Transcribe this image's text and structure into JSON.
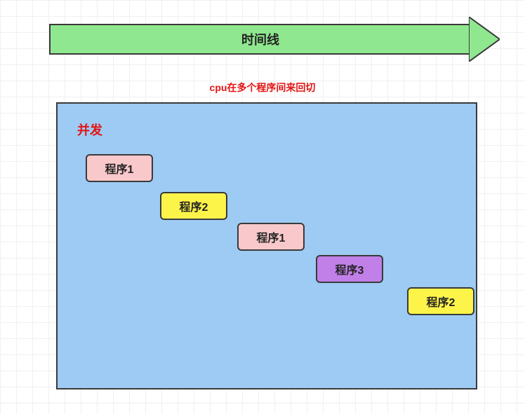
{
  "timeline": {
    "label": "时间线"
  },
  "caption": "cpu在多个程序间来回切",
  "panel": {
    "title": "并发",
    "programs": [
      {
        "label": "程序1",
        "color": "pink"
      },
      {
        "label": "程序2",
        "color": "yellow"
      },
      {
        "label": "程序1",
        "color": "pink"
      },
      {
        "label": "程序3",
        "color": "purple"
      },
      {
        "label": "程序2",
        "color": "yellow"
      }
    ]
  },
  "colors": {
    "pink": "#F8C8CB",
    "yellow": "#FDF44A",
    "purple": "#C080E8",
    "panel": "#9DCBF3",
    "arrow": "#8FE88F",
    "accent": "#e31414"
  }
}
